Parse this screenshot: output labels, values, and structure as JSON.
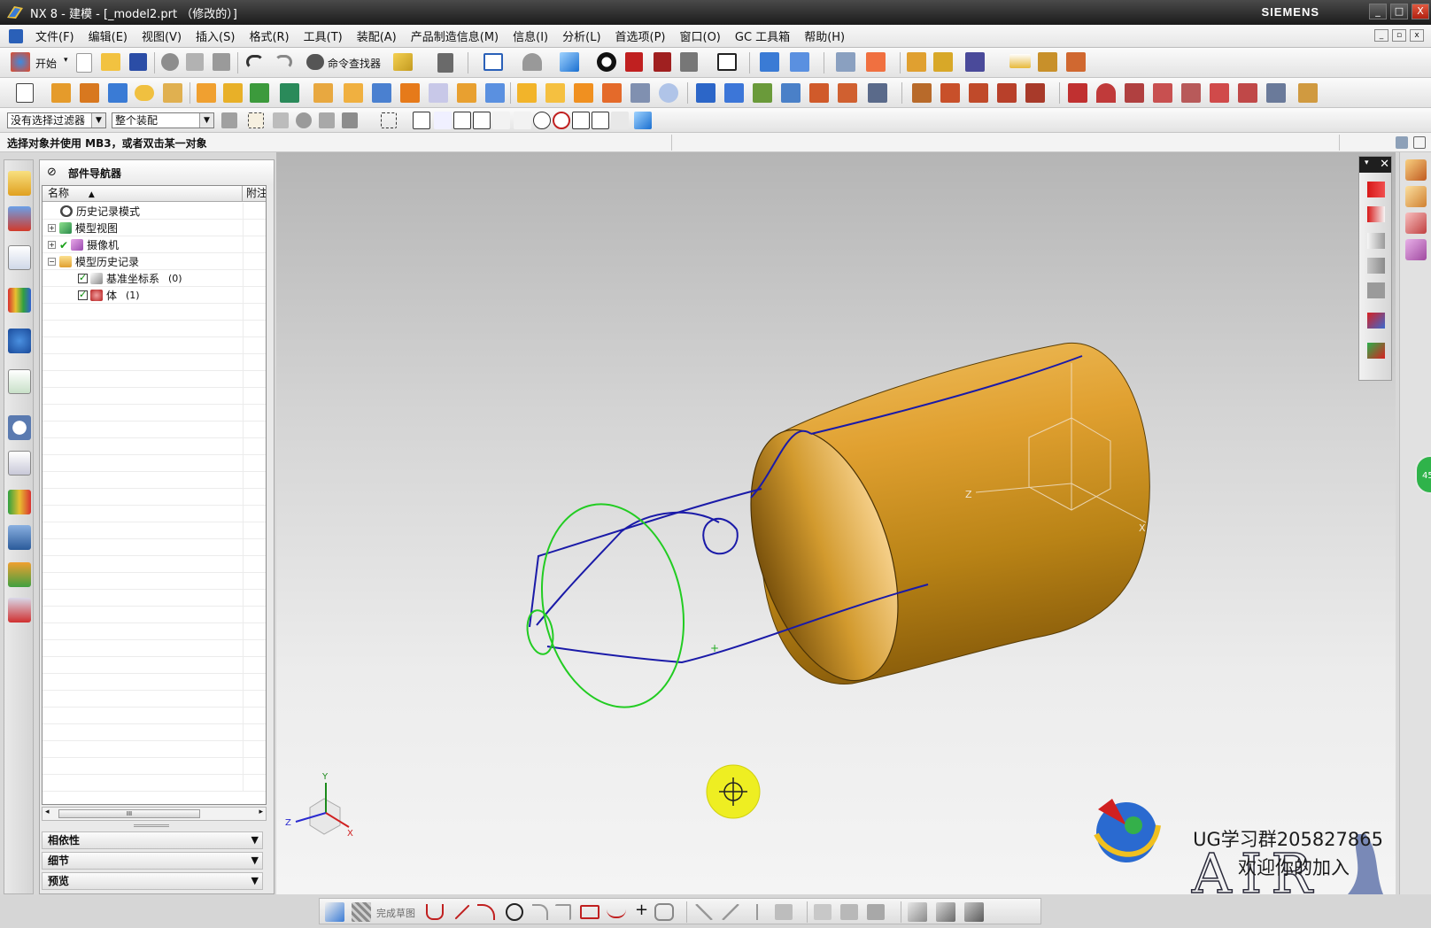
{
  "window": {
    "title": "NX 8 - 建模 - [_model2.prt （修改的）]",
    "brand": "SIEMENS",
    "controls": [
      "_",
      "□",
      "X"
    ]
  },
  "menu": {
    "items": [
      "文件(F)",
      "编辑(E)",
      "视图(V)",
      "插入(S)",
      "格式(R)",
      "工具(T)",
      "装配(A)",
      "产品制造信息(M)",
      "信息(I)",
      "分析(L)",
      "首选项(P)",
      "窗口(O)",
      "GC 工具箱",
      "帮助(H)"
    ]
  },
  "toolbar": {
    "start_label": "开始",
    "command_finder_label": "命令查找器"
  },
  "selection": {
    "filter_value": "没有选择过滤器",
    "scope_value": "整个装配"
  },
  "status": {
    "prompt": "选择对象并使用 MB3，或者双击某一对象"
  },
  "navigator": {
    "title": "部件导航器",
    "columns": {
      "name": "名称",
      "attached": "附注"
    },
    "sort_indicator": "▲",
    "nodes": [
      {
        "label": "历史记录模式"
      },
      {
        "label": "模型视图",
        "expander": "+"
      },
      {
        "label": "摄像机",
        "expander": "+"
      },
      {
        "label": "模型历史记录",
        "expander": "−"
      },
      {
        "label": "基准坐标系",
        "count": "(0)"
      },
      {
        "label": "体",
        "count": "(1)"
      }
    ],
    "scroll_thumb": "III",
    "panels": [
      {
        "label": "相依性",
        "chevron": "▼"
      },
      {
        "label": "细节",
        "chevron": "▼"
      },
      {
        "label": "预览",
        "chevron": "▼"
      }
    ]
  },
  "graphics": {
    "csys_labels": {
      "z": "Z",
      "x": "X"
    },
    "triad_labels": {
      "y": "Y",
      "z": "Z",
      "x": "X"
    },
    "watermark_line1": "UG学习群205827865",
    "watermark_line2": "欢迎你的加入",
    "logo_text": "AIR",
    "colors": {
      "cylinder": "#d89b2a",
      "sketch_curves": "#1a1aa8",
      "section_circle": "#22cc22",
      "cursor": "#eeee22"
    }
  },
  "sketch_toolbar": {
    "finish_label": "完成草图"
  },
  "badge": {
    "text": "45"
  },
  "selbar": {
    "close": "✕"
  }
}
